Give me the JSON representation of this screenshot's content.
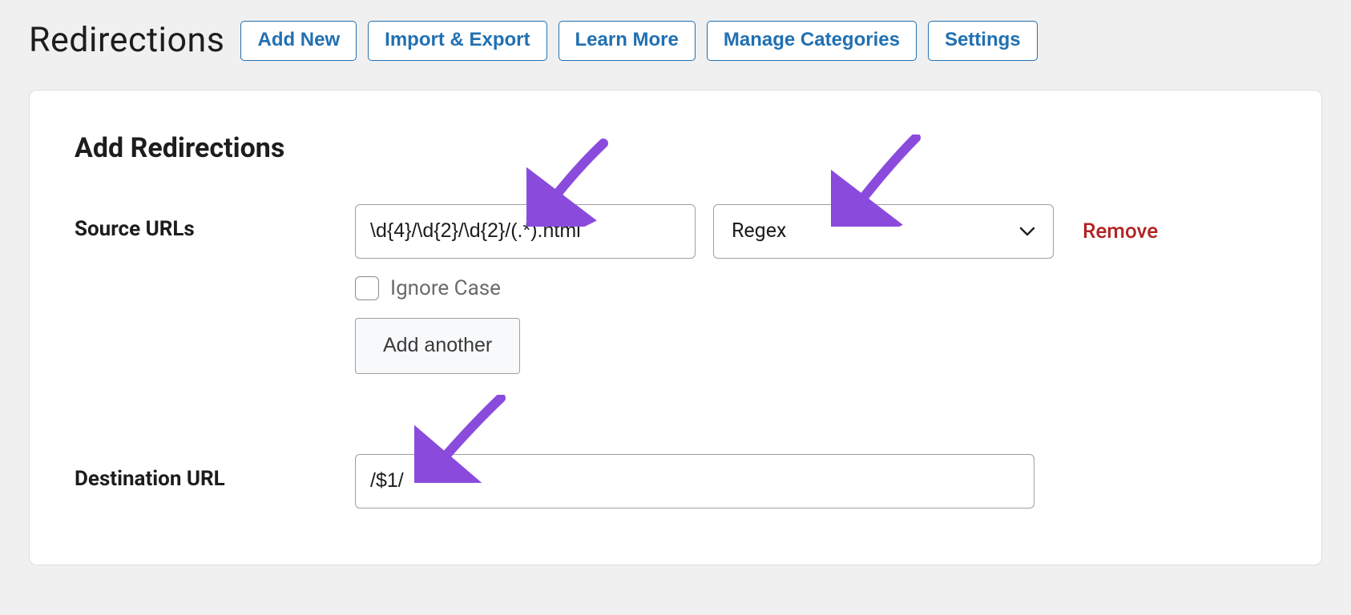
{
  "header": {
    "title": "Redirections",
    "buttons": {
      "add_new": "Add New",
      "import_export": "Import & Export",
      "learn_more": "Learn More",
      "manage_categories": "Manage Categories",
      "settings": "Settings"
    }
  },
  "panel": {
    "heading": "Add Redirections",
    "source": {
      "label": "Source URLs",
      "value": "\\d{4}/\\d{2}/\\d{2}/(.*).html",
      "match_type": "Regex",
      "ignore_case_label": "Ignore Case",
      "ignore_case_checked": false,
      "add_another_label": "Add another",
      "remove_label": "Remove"
    },
    "destination": {
      "label": "Destination URL",
      "value": "/$1/"
    }
  },
  "colors": {
    "arrow": "#8a4bdd"
  }
}
